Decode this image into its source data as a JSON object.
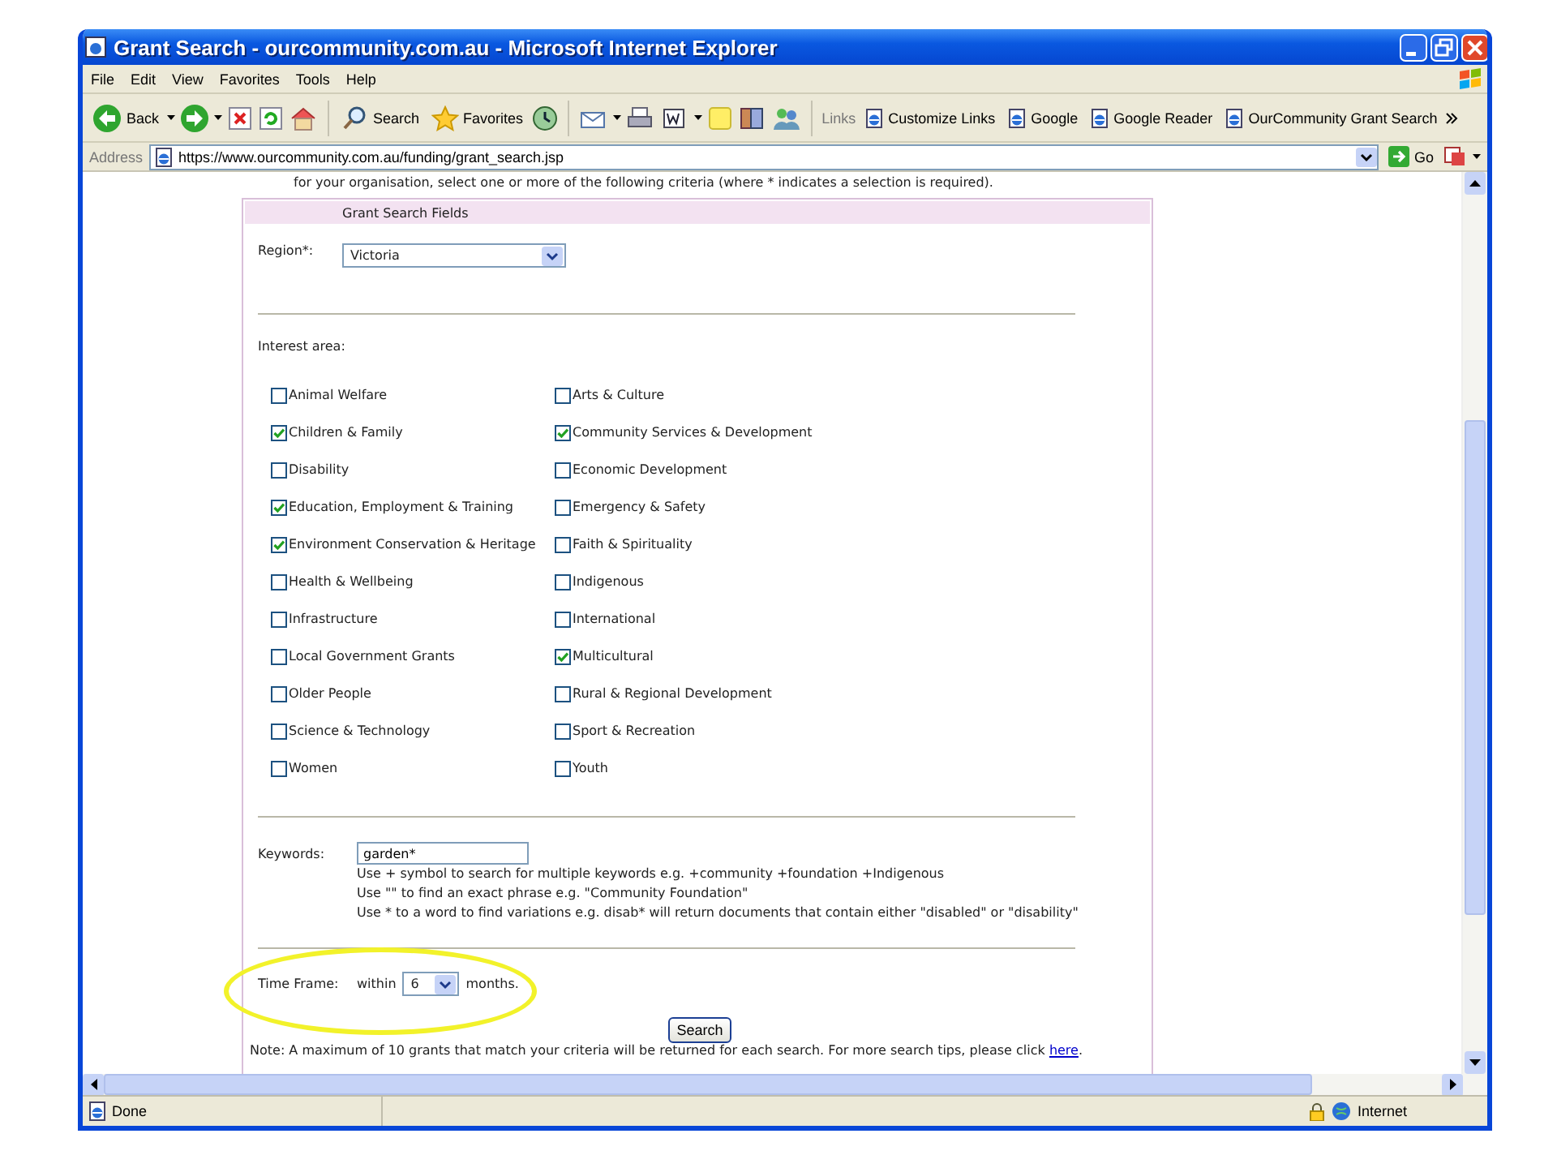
{
  "window": {
    "title": "Grant Search - ourcommunity.com.au - Microsoft Internet Explorer"
  },
  "menu_bar": [
    "File",
    "Edit",
    "View",
    "Favorites",
    "Tools",
    "Help"
  ],
  "toolbar": {
    "back": "Back",
    "search": "Search",
    "favorites": "Favorites"
  },
  "links_bar": {
    "label": "Links",
    "items": [
      "Customize Links",
      "Google",
      "Google Reader",
      "OurCommunity Grant Search"
    ]
  },
  "address_bar": {
    "label": "Address",
    "url": "https://www.ourcommunity.com.au/funding/grant_search.jsp",
    "go": "Go"
  },
  "page": {
    "intro": "for your organisation, select one or more of the following criteria (where * indicates a selection is required).",
    "panel_title": "Grant Search Fields",
    "region": {
      "label": "Region*:",
      "value": "Victoria"
    },
    "interest_area": {
      "label": "Interest area:",
      "options": [
        {
          "label": "Animal Welfare",
          "checked": false
        },
        {
          "label": "Arts & Culture",
          "checked": false
        },
        {
          "label": "Children & Family",
          "checked": true
        },
        {
          "label": "Community Services & Development",
          "checked": true
        },
        {
          "label": "Disability",
          "checked": false
        },
        {
          "label": "Economic Development",
          "checked": false
        },
        {
          "label": "Education, Employment & Training",
          "checked": true
        },
        {
          "label": "Emergency & Safety",
          "checked": false
        },
        {
          "label": "Environment Conservation & Heritage",
          "checked": true
        },
        {
          "label": "Faith & Spirituality",
          "checked": false
        },
        {
          "label": "Health & Wellbeing",
          "checked": false
        },
        {
          "label": "Indigenous",
          "checked": false
        },
        {
          "label": "Infrastructure",
          "checked": false
        },
        {
          "label": "International",
          "checked": false
        },
        {
          "label": "Local Government Grants",
          "checked": false
        },
        {
          "label": "Multicultural",
          "checked": true
        },
        {
          "label": "Older People",
          "checked": false
        },
        {
          "label": "Rural & Regional Development",
          "checked": false
        },
        {
          "label": "Science & Technology",
          "checked": false
        },
        {
          "label": "Sport & Recreation",
          "checked": false
        },
        {
          "label": "Women",
          "checked": false
        },
        {
          "label": "Youth",
          "checked": false
        }
      ]
    },
    "keywords": {
      "label": "Keywords:",
      "value": "garden*",
      "hints": [
        "Use + symbol to search for multiple keywords e.g. +community +foundation +Indigenous",
        "Use \"\" to find an exact phrase e.g. \"Community Foundation\"",
        "Use * to a word to find variations e.g. disab* will return documents that contain either \"disabled\" or \"disability\""
      ]
    },
    "time_frame": {
      "label": "Time Frame:",
      "prefix": "within",
      "value": "6",
      "suffix": "months."
    },
    "search_button": "Search",
    "note": {
      "text": "Note: A maximum of 10 grants that match your criteria will be returned for each search. For more search tips, please click ",
      "link": "here",
      "end": "."
    }
  },
  "status_bar": {
    "status": "Done",
    "zone": "Internet"
  }
}
